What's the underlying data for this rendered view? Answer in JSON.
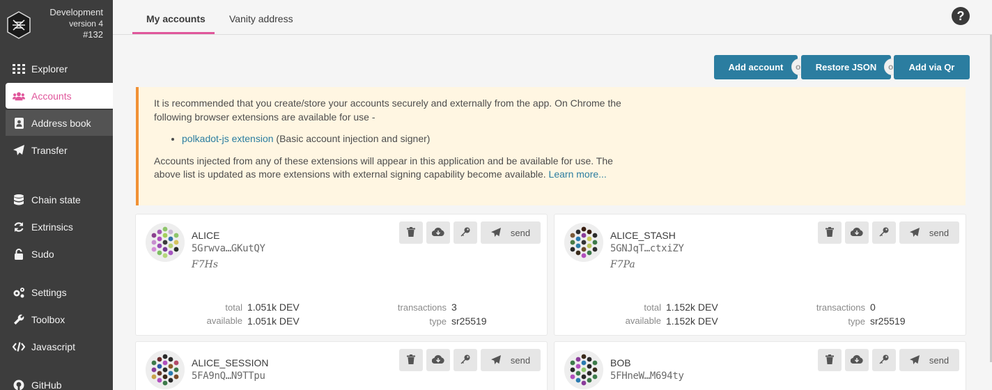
{
  "app": {
    "chain_name": "Development",
    "version": "version 4",
    "build": "#132"
  },
  "sidebar": {
    "items": [
      {
        "label": "Explorer",
        "icon": "grid-icon"
      },
      {
        "label": "Accounts",
        "icon": "users-icon"
      },
      {
        "label": "Address book",
        "icon": "address-book-icon"
      },
      {
        "label": "Transfer",
        "icon": "paper-plane-icon"
      },
      {
        "label": "Chain state",
        "icon": "database-icon"
      },
      {
        "label": "Extrinsics",
        "icon": "sync-icon"
      },
      {
        "label": "Sudo",
        "icon": "unlock-icon"
      },
      {
        "label": "Settings",
        "icon": "cogs-icon"
      },
      {
        "label": "Toolbox",
        "icon": "wrench-icon"
      },
      {
        "label": "Javascript",
        "icon": "code-icon"
      },
      {
        "label": "GitHub",
        "icon": "github-icon"
      }
    ]
  },
  "tabs": [
    {
      "label": "My accounts"
    },
    {
      "label": "Vanity address"
    }
  ],
  "help_label": "?",
  "actions": {
    "add_account": "Add account",
    "restore_json": "Restore JSON",
    "add_via_qr": "Add via Qr",
    "or": "or"
  },
  "notice": {
    "intro": "It is recommended that you create/store your accounts securely and externally from the app. On Chrome the following browser extensions are available for use -",
    "extension_link": "polkadot-js extension",
    "extension_desc": " (Basic account injection and signer)",
    "outro": "Accounts injected from any of these extensions will appear in this application and be available for use. The above list is updated as more extensions with external signing capability become available. ",
    "learn_more": "Learn more..."
  },
  "card_labels": {
    "total": "total",
    "available": "available",
    "transactions": "transactions",
    "type": "type",
    "send": "send"
  },
  "accounts": [
    {
      "name": "ALICE",
      "address": "5Grwva…GKutQY",
      "tag": "F7Hs",
      "total": "1.051k DEV",
      "available": "1.051k DEV",
      "transactions": "3",
      "type": "sr25519"
    },
    {
      "name": "ALICE_STASH",
      "address": "5GNJqT…ctxiZY",
      "tag": "F7Pa",
      "total": "1.152k DEV",
      "available": "1.152k DEV",
      "transactions": "0",
      "type": "sr25519"
    },
    {
      "name": "ALICE_SESSION",
      "address": "5FA9nQ…N9TTpu",
      "tag": "",
      "total": "",
      "available": "",
      "transactions": "",
      "type": ""
    },
    {
      "name": "BOB",
      "address": "5FHneW…M694ty",
      "tag": "",
      "total": "",
      "available": "",
      "transactions": "",
      "type": ""
    }
  ],
  "colors": {
    "sidebar_bg": "#3d3d3d",
    "accent_pink": "#e0569b",
    "button_blue": "#2b7da0",
    "notice_bg": "#fff6e2",
    "notice_border": "#f19135"
  }
}
